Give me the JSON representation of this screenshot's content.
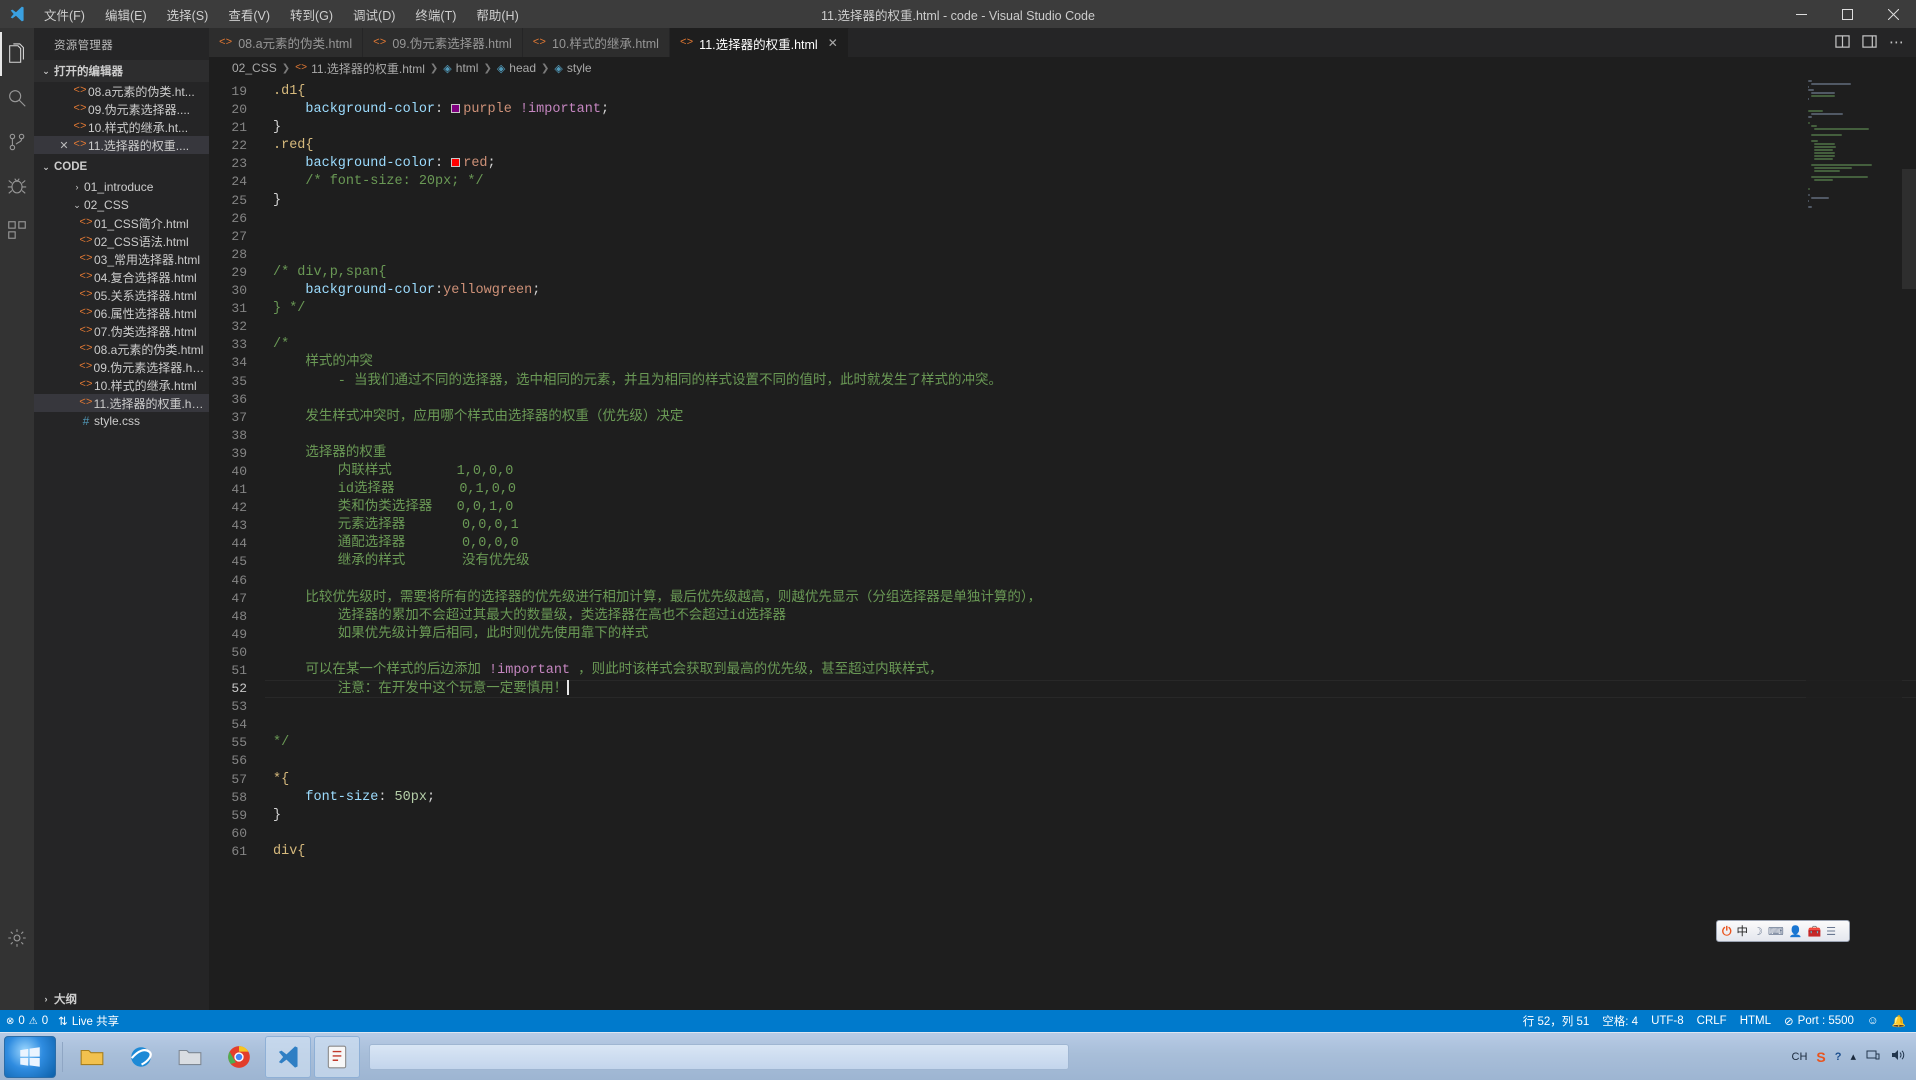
{
  "titlebar": {
    "window_title": "11.选择器的权重.html - code - Visual Studio Code",
    "menu": [
      {
        "label": "文件(F)",
        "name": "menu-file"
      },
      {
        "label": "编辑(E)",
        "name": "menu-edit"
      },
      {
        "label": "选择(S)",
        "name": "menu-selection"
      },
      {
        "label": "查看(V)",
        "name": "menu-view"
      },
      {
        "label": "转到(G)",
        "name": "menu-go"
      },
      {
        "label": "调试(D)",
        "name": "menu-debug"
      },
      {
        "label": "终端(T)",
        "name": "menu-terminal"
      },
      {
        "label": "帮助(H)",
        "name": "menu-help"
      }
    ],
    "controls": {
      "minimize": "—",
      "maximize": "☐",
      "close": "✕"
    }
  },
  "activitybar": {
    "items": [
      {
        "name": "explorer-icon",
        "label": "资源管理器"
      },
      {
        "name": "search-icon",
        "label": "搜索"
      },
      {
        "name": "source-control-icon",
        "label": "源代码管理"
      },
      {
        "name": "debug-icon",
        "label": "调试"
      },
      {
        "name": "extensions-icon",
        "label": "扩展"
      }
    ],
    "bottom": [
      {
        "name": "settings-gear-icon",
        "label": "管理"
      }
    ]
  },
  "sidebar": {
    "title": "资源管理器",
    "open_editors": {
      "header": "打开的编辑器",
      "items": [
        {
          "label": "08.a元素的伪类.ht...",
          "icon": "html-file-icon",
          "closable": false,
          "selected": false
        },
        {
          "label": "09.伪元素选择器....",
          "icon": "html-file-icon",
          "closable": false,
          "selected": false
        },
        {
          "label": "10.样式的继承.ht...",
          "icon": "html-file-icon",
          "closable": false,
          "selected": false
        },
        {
          "label": "11.选择器的权重....",
          "icon": "html-file-icon",
          "closable": true,
          "selected": true
        }
      ]
    },
    "workspace": {
      "header": "CODE",
      "folders": [
        {
          "label": "01_introduce",
          "expanded": false
        },
        {
          "label": "02_CSS",
          "expanded": true
        }
      ],
      "files": [
        {
          "label": "01_CSS简介.html",
          "icon": "html-file-icon",
          "selected": false
        },
        {
          "label": "02_CSS语法.html",
          "icon": "html-file-icon",
          "selected": false
        },
        {
          "label": "03_常用选择器.html",
          "icon": "html-file-icon",
          "selected": false
        },
        {
          "label": "04.复合选择器.html",
          "icon": "html-file-icon",
          "selected": false
        },
        {
          "label": "05.关系选择器.html",
          "icon": "html-file-icon",
          "selected": false
        },
        {
          "label": "06.属性选择器.html",
          "icon": "html-file-icon",
          "selected": false
        },
        {
          "label": "07.伪类选择器.html",
          "icon": "html-file-icon",
          "selected": false
        },
        {
          "label": "08.a元素的伪类.html",
          "icon": "html-file-icon",
          "selected": false
        },
        {
          "label": "09.伪元素选择器.html",
          "icon": "html-file-icon",
          "selected": false
        },
        {
          "label": "10.样式的继承.html",
          "icon": "html-file-icon",
          "selected": false
        },
        {
          "label": "11.选择器的权重.html",
          "icon": "html-file-icon",
          "selected": true
        },
        {
          "label": "style.css",
          "icon": "css-file-icon",
          "selected": false
        }
      ]
    },
    "outline": {
      "header": "大纲"
    }
  },
  "tabs": [
    {
      "label": "08.a元素的伪类.html",
      "active": false,
      "dirty": false
    },
    {
      "label": "09.伪元素选择器.html",
      "active": false,
      "dirty": false
    },
    {
      "label": "10.样式的继承.html",
      "active": false,
      "dirty": false
    },
    {
      "label": "11.选择器的权重.html",
      "active": true,
      "dirty": false
    }
  ],
  "tab_actions": [
    {
      "name": "split-editor-icon"
    },
    {
      "name": "layout-panel-icon"
    },
    {
      "name": "more-actions-icon"
    }
  ],
  "breadcrumb": [
    {
      "label": "02_CSS",
      "icon": "folder"
    },
    {
      "label": "11.选择器的权重.html",
      "icon": "html"
    },
    {
      "label": "html",
      "icon": "tag"
    },
    {
      "label": "head",
      "icon": "tag"
    },
    {
      "label": "style",
      "icon": "tag"
    }
  ],
  "editor": {
    "first_line": 19,
    "current_line": 52,
    "lines": [
      {
        "n": 19,
        "text": ".d1{"
      },
      {
        "n": 20,
        "text": "    background-color: purple !important;"
      },
      {
        "n": 21,
        "text": "}"
      },
      {
        "n": 22,
        "text": ".red{"
      },
      {
        "n": 23,
        "text": "    background-color: red;"
      },
      {
        "n": 24,
        "text": "    /* font-size: 20px; */"
      },
      {
        "n": 25,
        "text": "}"
      },
      {
        "n": 26,
        "text": ""
      },
      {
        "n": 27,
        "text": ""
      },
      {
        "n": 28,
        "text": ""
      },
      {
        "n": 29,
        "text": "/* div,p,span{"
      },
      {
        "n": 30,
        "text": "    background-color:yellowgreen;"
      },
      {
        "n": 31,
        "text": "} */"
      },
      {
        "n": 32,
        "text": ""
      },
      {
        "n": 33,
        "text": "/*"
      },
      {
        "n": 34,
        "text": "    样式的冲突"
      },
      {
        "n": 35,
        "text": "        - 当我们通过不同的选择器，选中相同的元素，并且为相同的样式设置不同的值时，此时就发生了样式的冲突。"
      },
      {
        "n": 36,
        "text": ""
      },
      {
        "n": 37,
        "text": "    发生样式冲突时，应用哪个样式由选择器的权重（优先级）决定"
      },
      {
        "n": 38,
        "text": ""
      },
      {
        "n": 39,
        "text": "    选择器的权重"
      },
      {
        "n": 40,
        "text": "        内联样式        1,0,0,0"
      },
      {
        "n": 41,
        "text": "        id选择器        0,1,0,0"
      },
      {
        "n": 42,
        "text": "        类和伪类选择器   0,0,1,0"
      },
      {
        "n": 43,
        "text": "        元素选择器       0,0,0,1"
      },
      {
        "n": 44,
        "text": "        通配选择器       0,0,0,0"
      },
      {
        "n": 45,
        "text": "        继承的样式       没有优先级"
      },
      {
        "n": 46,
        "text": ""
      },
      {
        "n": 47,
        "text": "    比较优先级时，需要将所有的选择器的优先级进行相加计算，最后优先级越高，则越优先显示（分组选择器是单独计算的），"
      },
      {
        "n": 48,
        "text": "        选择器的累加不会超过其最大的数量级，类选择器在高也不会超过id选择器"
      },
      {
        "n": 49,
        "text": "        如果优先级计算后相同，此时则优先使用靠下的样式"
      },
      {
        "n": 50,
        "text": ""
      },
      {
        "n": 51,
        "text": "    可以在某一个样式的后边添加 !important ，则此时该样式会获取到最高的优先级，甚至超过内联样式，"
      },
      {
        "n": 52,
        "text": "        注意：在开发中这个玩意一定要慎用！"
      },
      {
        "n": 53,
        "text": ""
      },
      {
        "n": 54,
        "text": ""
      },
      {
        "n": 55,
        "text": "*/"
      },
      {
        "n": 56,
        "text": ""
      },
      {
        "n": 57,
        "text": "*{"
      },
      {
        "n": 58,
        "text": "    font-size: 50px;"
      },
      {
        "n": 59,
        "text": "}"
      },
      {
        "n": 60,
        "text": ""
      },
      {
        "n": 61,
        "text": "div{"
      }
    ],
    "swatch_colors": {
      "purple": "#800080",
      "red": "#ff0000"
    }
  },
  "ime": {
    "engine": "sogou",
    "mode_label": "中",
    "icons": [
      "moon-icon",
      "keyboard-icon",
      "person-icon",
      "toolbox-icon",
      "menu-icon"
    ]
  },
  "statusbar": {
    "errors": "0",
    "warnings": "0",
    "live_share": "Live 共享",
    "cursor_position": "行 52，列 51",
    "indentation": "空格: 4",
    "encoding": "UTF-8",
    "eol": "CRLF",
    "language": "HTML",
    "port": "Port : 5500",
    "feedback_icon": "smiley-icon",
    "bell_icon": "bell-icon"
  },
  "taskbar": {
    "start_label": "开始",
    "items": [
      {
        "name": "taskbar-explorer",
        "label": "文件资源管理器"
      },
      {
        "name": "taskbar-ie",
        "label": "Internet Explorer"
      },
      {
        "name": "taskbar-folder",
        "label": "文件夹"
      },
      {
        "name": "taskbar-chrome",
        "label": "Google Chrome"
      },
      {
        "name": "taskbar-vscode",
        "label": "Visual Studio Code"
      },
      {
        "name": "taskbar-editor",
        "label": "编辑器"
      }
    ],
    "tray": {
      "ime": "CH",
      "icons": [
        "sogou-icon",
        "help-icon",
        "show-hidden-icon",
        "network-icon",
        "volume-icon"
      ]
    }
  },
  "colors": {
    "accent": "#007acc",
    "titlebar_bg": "#3c3c3c",
    "sidebar_bg": "#252526",
    "editor_bg": "#1e1e1e",
    "comment_green": "#6a9955",
    "file_icon_orange": "#e37933"
  }
}
